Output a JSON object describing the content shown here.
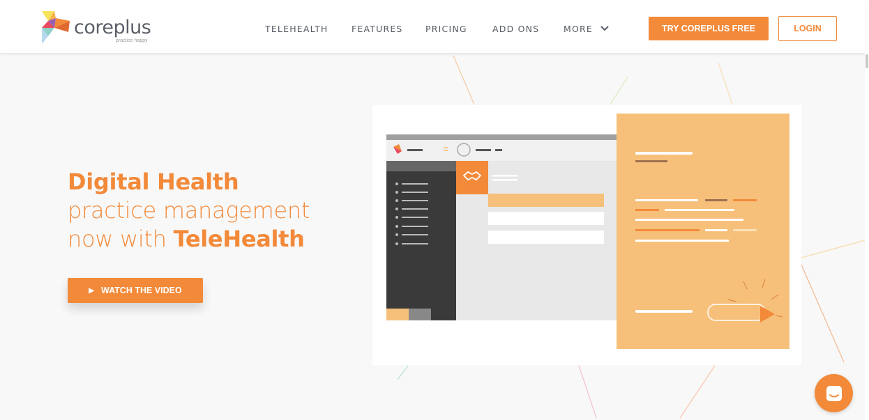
{
  "brand": {
    "name": "coreplus",
    "tagline": "practice happy",
    "accent": "#f28a3a"
  },
  "nav": {
    "items": [
      "TELEHEALTH",
      "FEATURES",
      "PRICING",
      "ADD ONS",
      "MORE"
    ],
    "more_icon": "chevron-down-icon"
  },
  "header": {
    "cta_label": "TRY COREPLUS FREE",
    "login_label": "LOGIN"
  },
  "hero": {
    "title": "Digital Health",
    "line2": "practice management",
    "line3_prefix": "now with ",
    "line3_bold": "TeleHealth",
    "video_button": "WATCH THE VIDEO",
    "video_icon": "play-icon"
  },
  "chat": {
    "icon": "chat-icon"
  }
}
